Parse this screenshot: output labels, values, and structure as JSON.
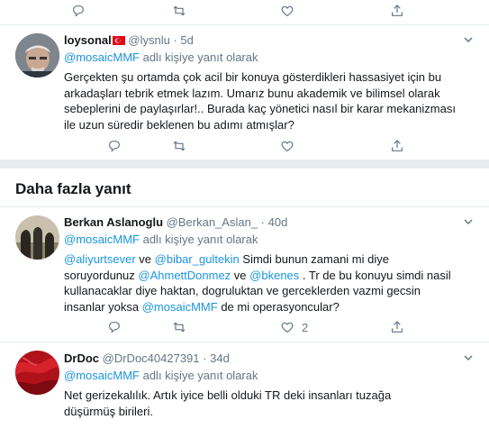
{
  "colors": {
    "link": "#1b95e0",
    "muted": "#657786",
    "divider": "#e6ecf0",
    "text": "#14171a"
  },
  "top_actions": {
    "retweet_icon": "retweet-icon",
    "like_icon": "heart-icon"
  },
  "tweet1": {
    "name": "loysonal",
    "handle": "@lysnlu",
    "dot": "·",
    "time": "5d",
    "reply_mention": "@mosaicMMF",
    "reply_suffix": " adlı kişiye yanıt olarak",
    "text": "Gerçekten şu ortamda çok acil  bir konuya gösterdikleri hassasiyet için bu arkadaşları tebrik etmek lazım. Umarız bunu akademik ve bilimsel olarak sebeplerini de paylaşırlar!.. Burada kaç yönetici nasıl bir karar mekanizması ile uzun süredir beklenen bu adımı atmışlar?"
  },
  "more_replies": {
    "title": "Daha fazla yanıt"
  },
  "tweet2": {
    "name": "Berkan Aslanoglu",
    "handle": "@Berkan_Aslan_",
    "dot": "·",
    "time": "40d",
    "reply_mention": "@mosaicMMF",
    "reply_suffix": " adlı kişiye yanıt olarak",
    "m1": "@aliyurtsever",
    "t1": " ve ",
    "m2": "@bibar_gultekin",
    "t2": " Simdi bunun zamani mi diye soruyordunuz ",
    "m3": "@AhmettDonmez",
    "t3": " ve ",
    "m4": "@bkenes",
    "t4": " . Tr de bu konuyu simdi nasil kullanacaklar diye haktan, dogruluktan ve gerceklerden vazmi gecsin insanlar yoksa ",
    "m5": "@mosaicMMF",
    "t5": " de mi operasyoncular?",
    "like_count": "2"
  },
  "tweet3": {
    "name": "DrDoc",
    "handle": "@DrDoc40427391",
    "dot": "·",
    "time": "34d",
    "reply_mention": "@mosaicMMF",
    "reply_suffix": " adlı kişiye yanıt olarak",
    "text": "Net gerizekalılık. Artık iyice belli olduki TR deki insanları tuzağa düşürmüş birileri."
  }
}
